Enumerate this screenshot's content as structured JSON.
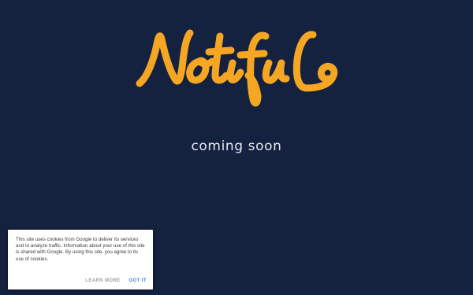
{
  "brand": {
    "logo_text": "Notiful",
    "logo_color": "#f5a623"
  },
  "tagline": "coming soon",
  "cookie_notice": {
    "message": "This site uses cookies from Google to deliver its services and to analyze traffic. Information about your use of this site is shared with Google. By using this site, you agree to its use of cookies.",
    "learn_more_label": "LEARN MORE",
    "got_it_label": "GOT IT"
  },
  "colors": {
    "background": "#142240",
    "accent_link": "#3d7fd6"
  }
}
